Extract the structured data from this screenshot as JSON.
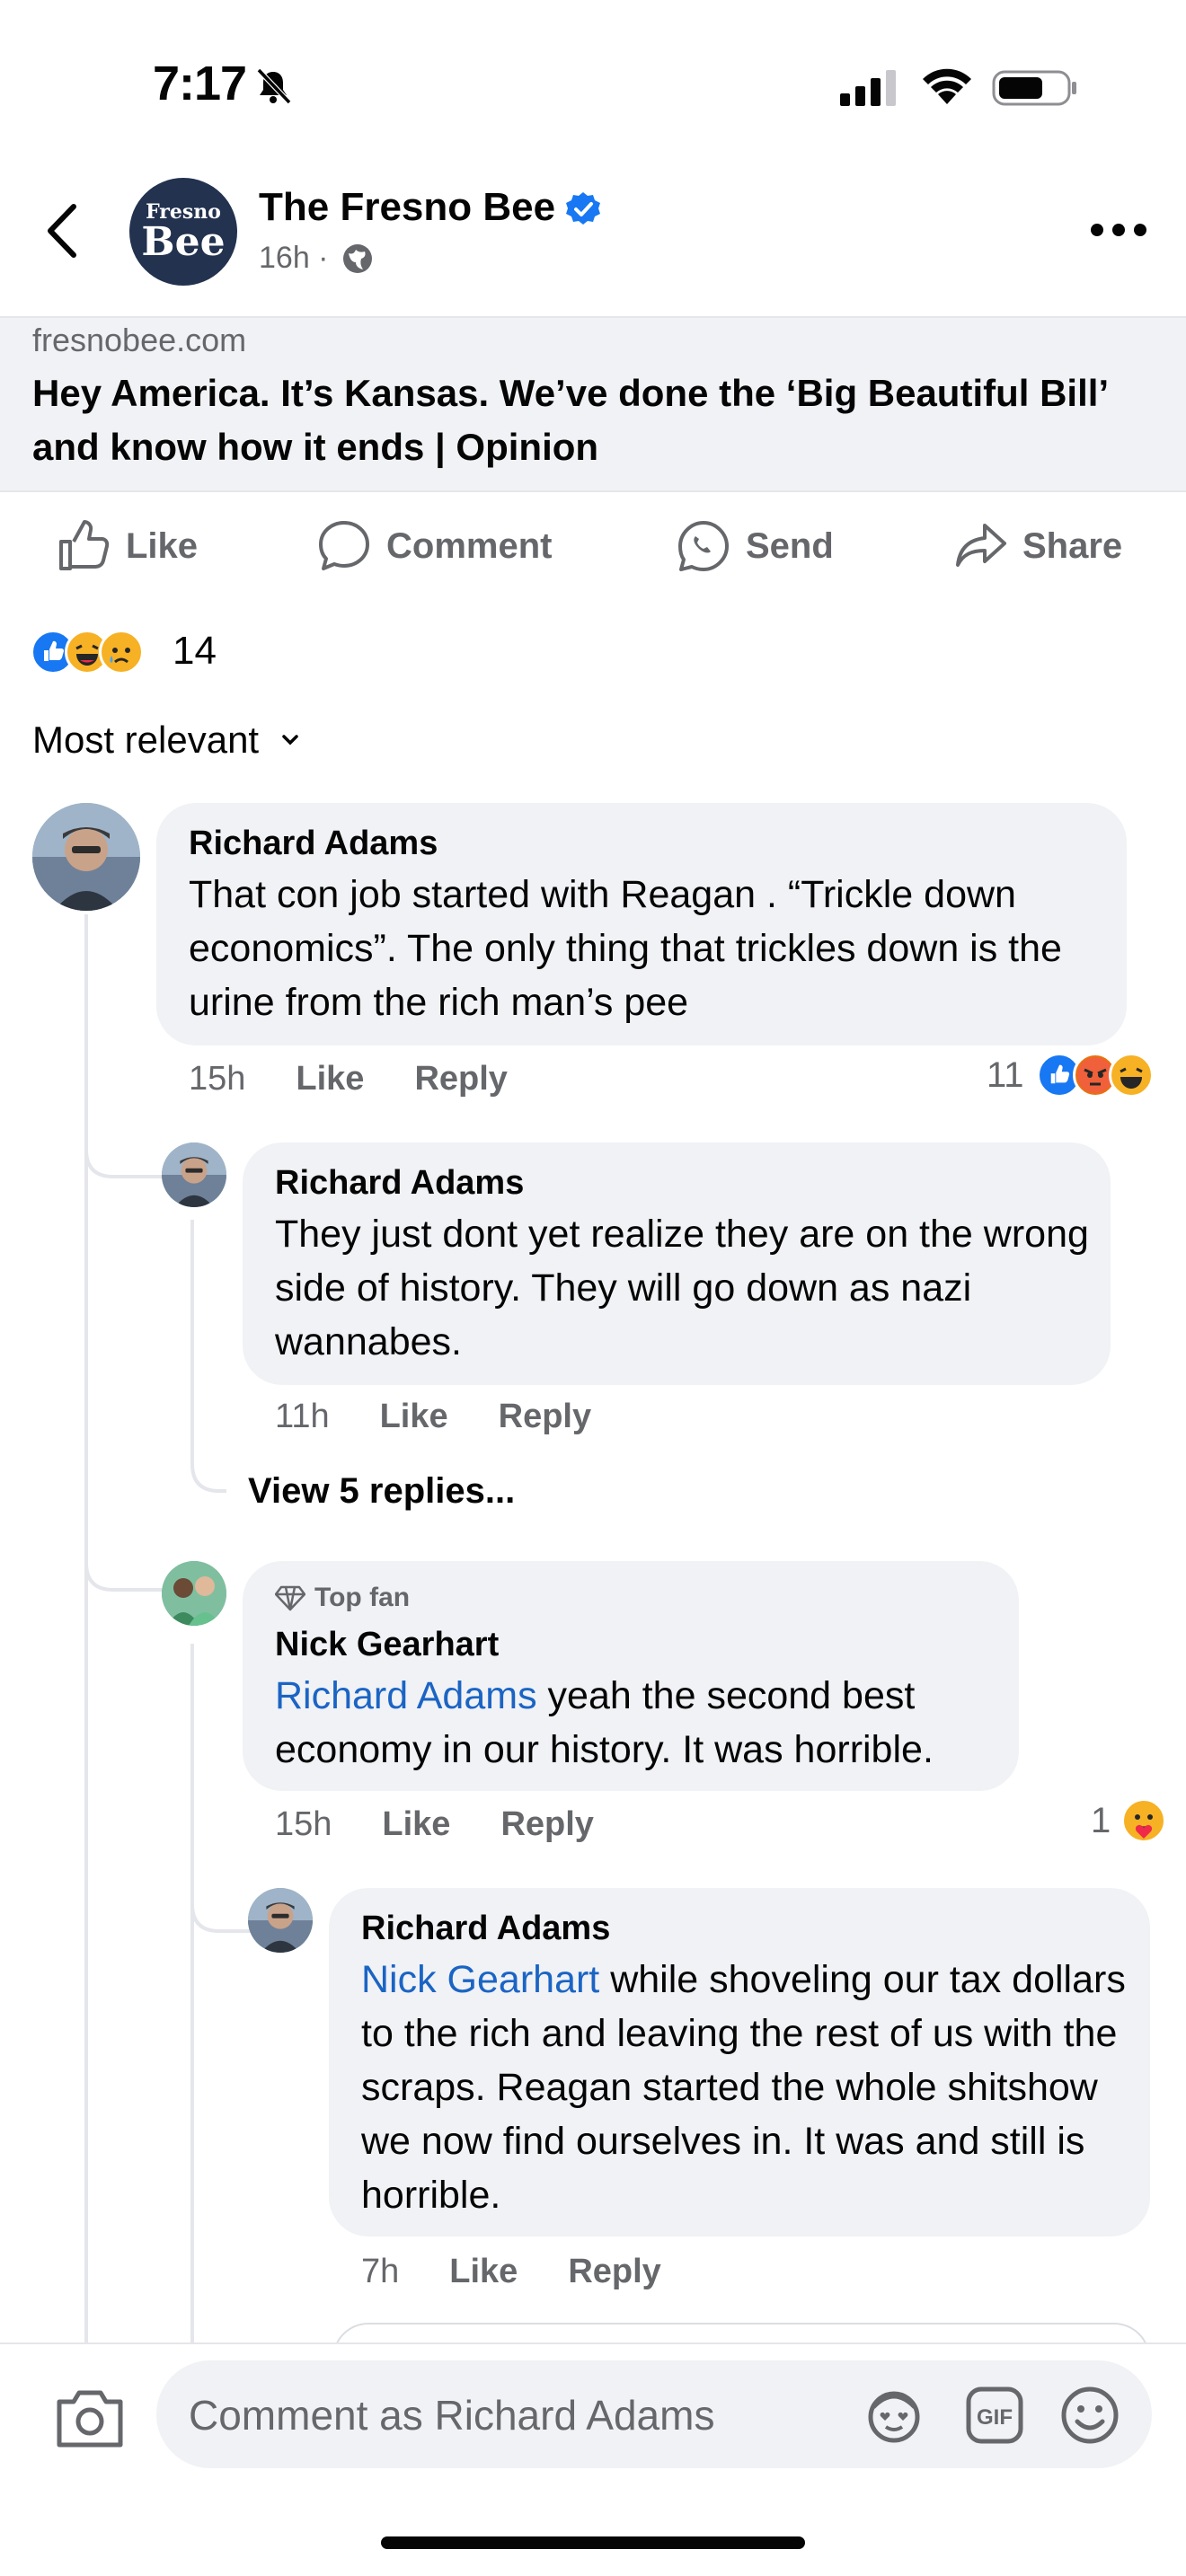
{
  "status_bar": {
    "time": "7:17"
  },
  "header": {
    "page_name": "The Fresno Bee",
    "post_time": "16h ·",
    "logo_line1": "Fresno",
    "logo_line2": "Bee"
  },
  "link_preview": {
    "domain": "fresnobee.com",
    "title": "Hey America. It’s Kansas. We’ve done the ‘Big Beautiful Bill’ and know how it ends | Opinion"
  },
  "actions": {
    "like": "Like",
    "comment": "Comment",
    "send": "Send",
    "share": "Share"
  },
  "reactions": {
    "count": "14"
  },
  "sort": {
    "label": "Most relevant"
  },
  "comments": [
    {
      "name": "Richard Adams",
      "text": "That con job started with Reagan .  “Trickle down economics”.   The only thing that trickles down is the urine from the rich man’s pee",
      "time": "15h",
      "like": "Like",
      "reply": "Reply",
      "reaction_count": "11"
    },
    {
      "name": "Richard Adams",
      "text": "They just dont yet realize they are on the wrong side of history.  They will go down as nazi wannabes.",
      "time": "11h",
      "like": "Like",
      "reply": "Reply",
      "view_replies": "View 5 replies..."
    },
    {
      "badge": "Top fan",
      "name": "Nick Gearhart",
      "mention": "Richard Adams",
      "text": " yeah the second best economy in our history. It was horrible.",
      "time": "15h",
      "like": "Like",
      "reply": "Reply",
      "reaction_count": "1"
    },
    {
      "name": "Richard Adams",
      "mention": "Nick Gearhart",
      "text": " while shoveling our tax dollars to the rich and leaving the rest of us with the scraps.  Reagan started the whole shitshow we now find ourselves in.  It was and still is horrible.",
      "time": "7h",
      "like": "Like",
      "reply": "Reply"
    }
  ],
  "composer": {
    "placeholder": "Comment as Richard Adams"
  },
  "colors": {
    "accent_blue": "#1877f2",
    "mention": "#1b64c4",
    "bubble": "#f0f2f5",
    "muted": "#65676b"
  }
}
